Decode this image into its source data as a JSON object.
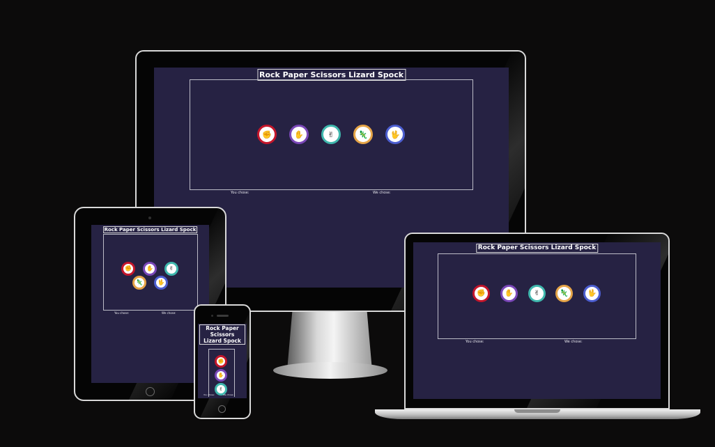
{
  "app": {
    "title": "Rock Paper Scissors Lizard Spock",
    "you_chose": "You chose:",
    "we_chose": "We chose:"
  },
  "choices": [
    {
      "id": "rock",
      "glyph": "✊",
      "color": "#c4162b"
    },
    {
      "id": "paper",
      "glyph": "✋",
      "color": "#7a47b8"
    },
    {
      "id": "scissors",
      "glyph": "✌",
      "color": "#3fb7ad"
    },
    {
      "id": "lizard",
      "glyph": "🦎",
      "color": "#e5a447"
    },
    {
      "id": "spock",
      "glyph": "🖖",
      "color": "#4c5ed0"
    }
  ],
  "colors": {
    "page_background": "#0c0b0b",
    "screen_background": "#262243",
    "board_border": "#bdbdc8"
  }
}
